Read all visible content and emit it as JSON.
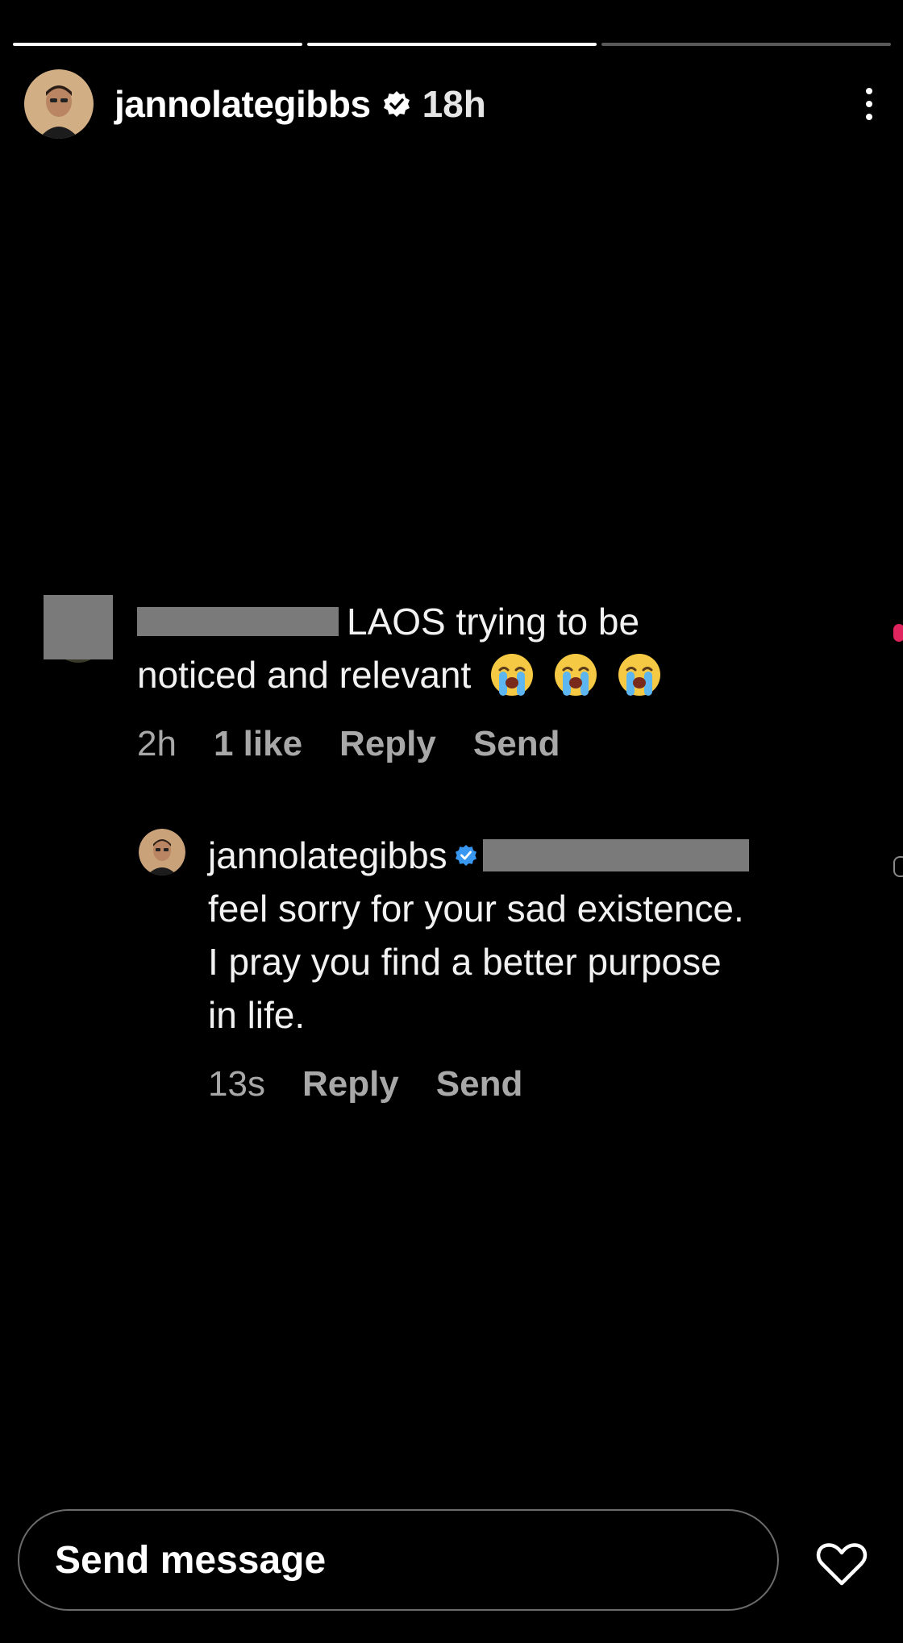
{
  "story": {
    "progress": [
      1.0,
      1.0,
      0.0
    ],
    "header": {
      "username": "jannolategibbs",
      "time": "18h",
      "verified": true,
      "avatar_icon": "profile-photo",
      "more_icon": "vertical-ellipsis-icon"
    }
  },
  "comments": [
    {
      "username_redacted": true,
      "text_line1": "LAOS trying to be",
      "text_line2": "noticed and relevant",
      "emoji": [
        "loudly-crying-face",
        "loudly-crying-face",
        "loudly-crying-face"
      ],
      "time": "2h",
      "likes": "1 like",
      "reply_label": "Reply",
      "send_label": "Send"
    },
    {
      "username": "jannolategibbs",
      "verified": true,
      "mention_redacted": true,
      "text_line1": "feel sorry for your sad existence.",
      "text_line2": "I pray you find a better purpose",
      "text_line3": "in life.",
      "time": "13s",
      "reply_label": "Reply",
      "send_label": "Send"
    }
  ],
  "footer": {
    "send_placeholder": "Send message",
    "heart_icon": "heart-outline-icon"
  },
  "colors": {
    "background": "#000000",
    "text": "#ffffff",
    "meta_text": "#a8a8a8",
    "verified_blue": "#3897f0",
    "redaction_gray": "#7a7a7a",
    "like_red": "#e0245e"
  }
}
